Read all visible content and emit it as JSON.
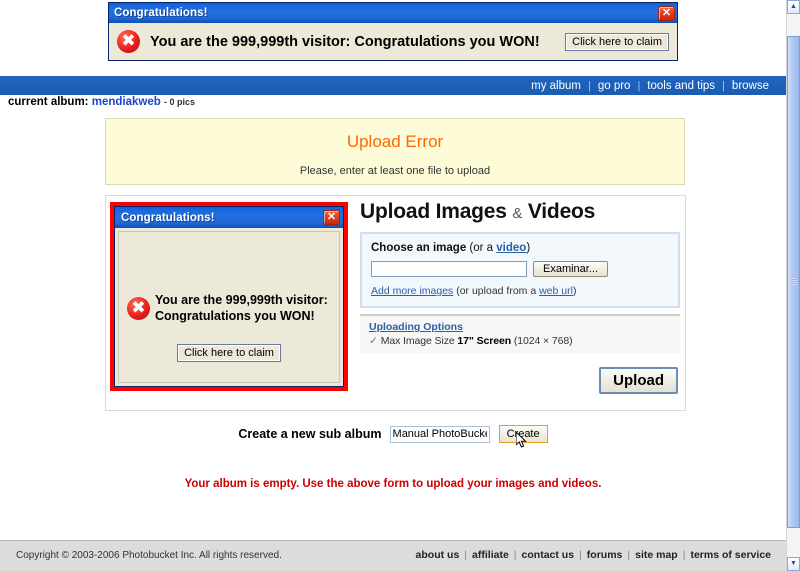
{
  "popup_top": {
    "title": "Congratulations!",
    "close_label": "✕",
    "icon": "error-x-icon",
    "message": "You are the 999,999th visitor: Congratulations you WON!",
    "claim_button": "Click here to claim"
  },
  "popup_inner": {
    "title": "Congratulations!",
    "close_label": "✕",
    "icon": "error-x-icon",
    "message_line1": "You are the 999,999th visitor:",
    "message_line2": "Congratulations you WON!",
    "claim_button": "Click here to claim",
    "border_color": "#ff0000"
  },
  "nav": {
    "items": [
      {
        "label": "my album"
      },
      {
        "label": "go pro"
      },
      {
        "label": "tools and tips"
      },
      {
        "label": "browse"
      }
    ],
    "separator": "|",
    "background": "#1a5eb8"
  },
  "album": {
    "prefix": "current album:",
    "name": "mendiakweb",
    "count": "- 0 pics"
  },
  "error_box": {
    "title": "Upload Error",
    "title_color": "#ff6600",
    "message": "Please, enter at least one file to upload",
    "background": "#fdfbd8"
  },
  "upload": {
    "heading_main": "Upload Images",
    "heading_amp": "&",
    "heading_tail": "Videos",
    "choose_label_bold": "Choose an image",
    "choose_label_pre": " (or a ",
    "choose_label_link": "video",
    "choose_label_post": ")",
    "file_value": "",
    "file_placeholder": "",
    "browse_button": "Examinar...",
    "add_more_link": "Add more images",
    "add_more_mid": " (or upload from a ",
    "web_url_link": "web url",
    "add_more_end": ")",
    "options_link": "Uploading Options",
    "option_check": "✓",
    "option_pre": "Max Image Size ",
    "option_bold": "17\" Screen",
    "option_post": " (1024 × 768)",
    "upload_button": "Upload"
  },
  "sub_album": {
    "label": "Create a new sub album",
    "input_value": "Manual PhotoBucket",
    "create_button": "Create",
    "create_border_color": "#e6a01e"
  },
  "empty_notice": {
    "text": "Your album is empty. Use the above form to upload your images and videos.",
    "color": "#cc0000"
  },
  "footer": {
    "copyright": "Copyright © 2003-2006 Photobucket Inc. All rights reserved.",
    "links": [
      {
        "label": "about us"
      },
      {
        "label": "affiliate"
      },
      {
        "label": "contact us"
      },
      {
        "label": "forums"
      },
      {
        "label": "site map"
      },
      {
        "label": "terms of service"
      }
    ],
    "separator": "|"
  },
  "scrollbar": {
    "up_arrow": "▲",
    "down_arrow": "▼"
  }
}
